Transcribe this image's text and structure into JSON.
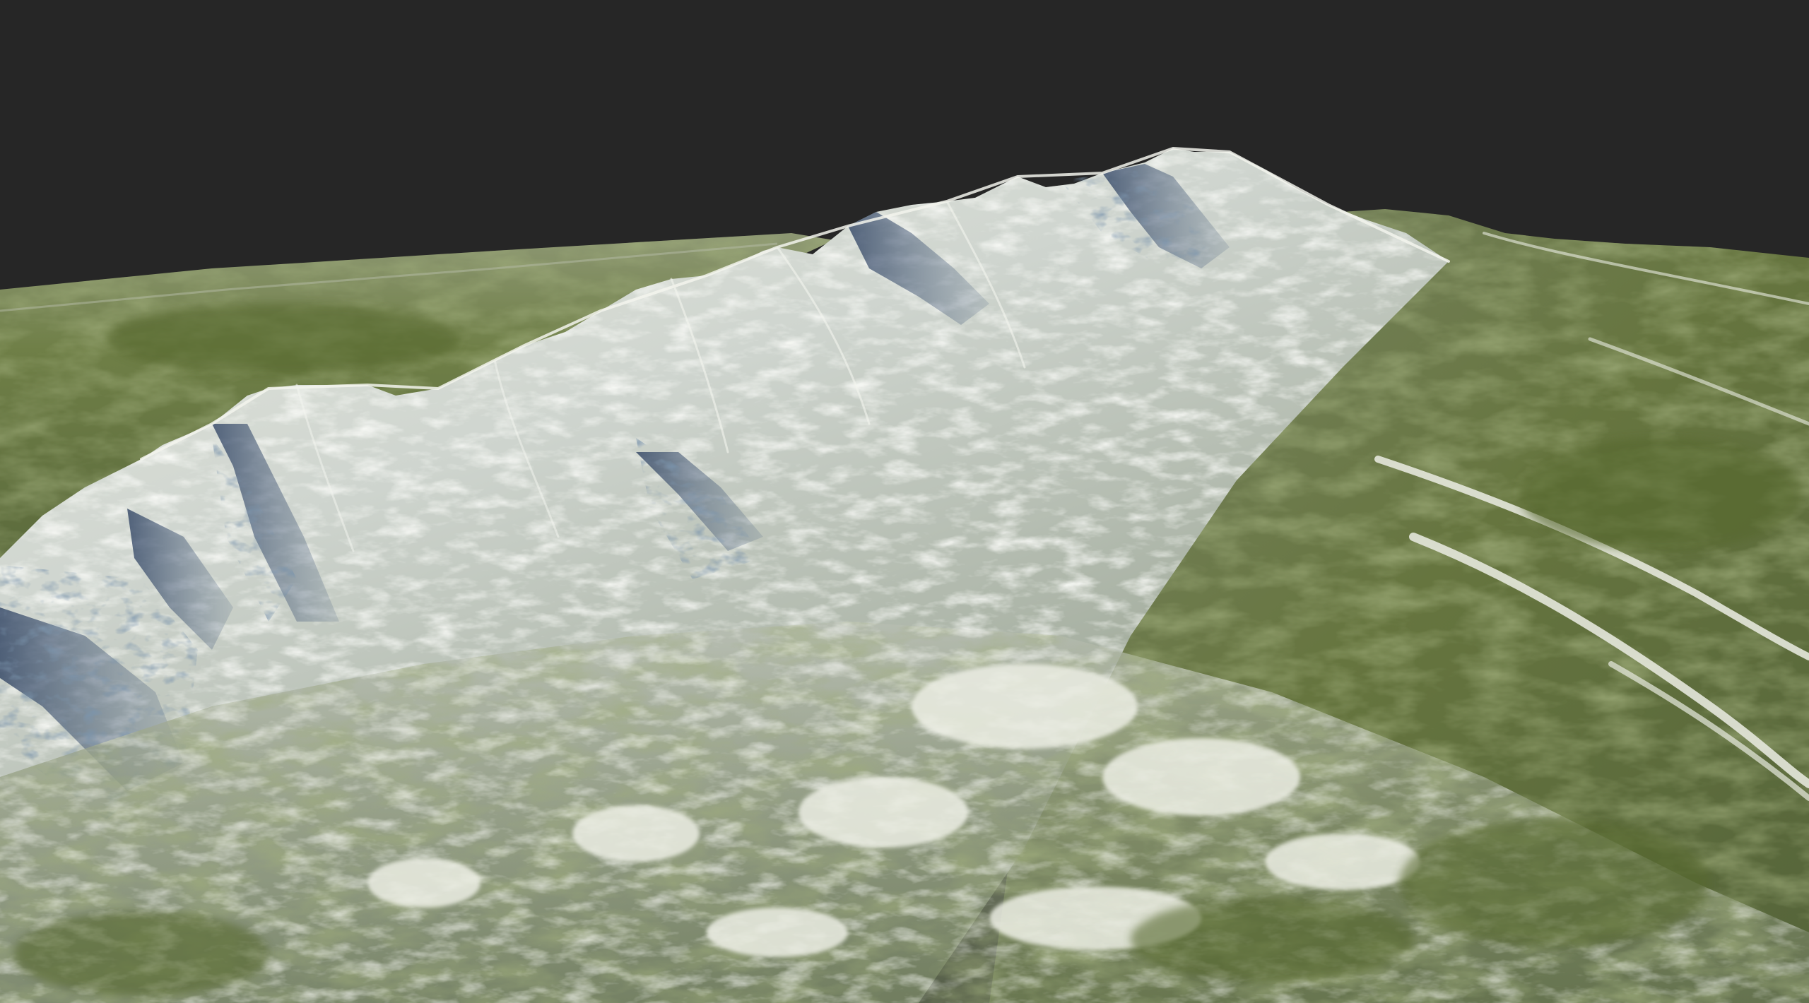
{
  "scene": {
    "type": "3d-terrain-render",
    "colors": {
      "sky": "#262626",
      "grass": "#5d6c3e",
      "grass_light": "#8a9866",
      "rock_shadow": "#2f4668",
      "rock_mid": "#6e7f93",
      "snow": "#eceee4",
      "snow_shadow": "#b9c3cc",
      "lowland": "#74805a"
    },
    "hud": {}
  }
}
